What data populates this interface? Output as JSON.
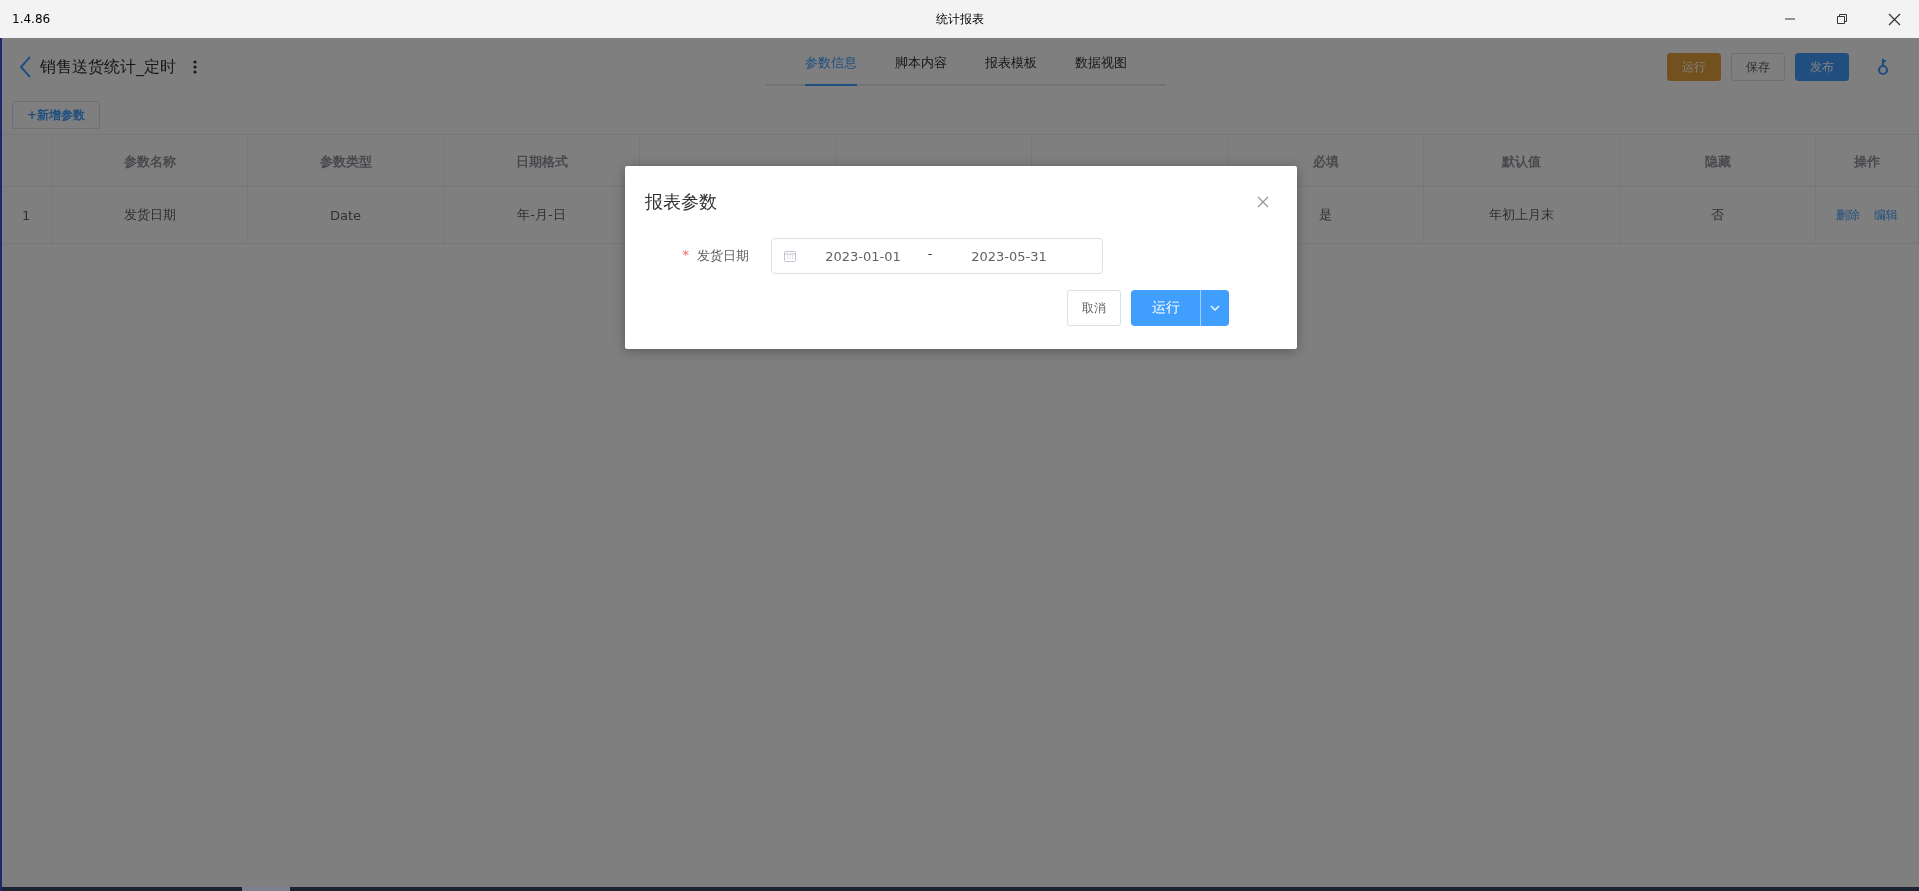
{
  "window": {
    "version": "1.4.86",
    "title": "统计报表"
  },
  "header": {
    "title": "销售送货统计_定时"
  },
  "tabs": [
    {
      "label": "参数信息",
      "selected": true
    },
    {
      "label": "脚本内容",
      "selected": false
    },
    {
      "label": "报表模板",
      "selected": false
    },
    {
      "label": "数据视图",
      "selected": false
    }
  ],
  "actions": [
    {
      "label": "运行",
      "kind": "warning"
    },
    {
      "label": "保存",
      "kind": "default"
    },
    {
      "label": "发布",
      "kind": "primary"
    }
  ],
  "add_button": "+新增参数",
  "table": {
    "columns": [
      "参数名称",
      "参数类型",
      "日期格式",
      "必填",
      "默认值",
      "隐藏",
      "操作"
    ],
    "rows": [
      {
        "index": "1",
        "name": "发货日期",
        "type": "Date",
        "date_format": "年-月-日",
        "required": "是",
        "default": "年初上月末",
        "hidden": "否",
        "actions": [
          "删除",
          "编辑"
        ]
      }
    ]
  },
  "dialog": {
    "title": "报表参数",
    "fields": [
      {
        "label": "发货日期",
        "required": true,
        "required_mark": "*",
        "start": "2023-01-01",
        "separator": "-",
        "end": "2023-05-31"
      }
    ],
    "buttons": [
      {
        "label": "取消",
        "kind": "default"
      },
      {
        "label": "运行",
        "kind": "split"
      }
    ]
  }
}
